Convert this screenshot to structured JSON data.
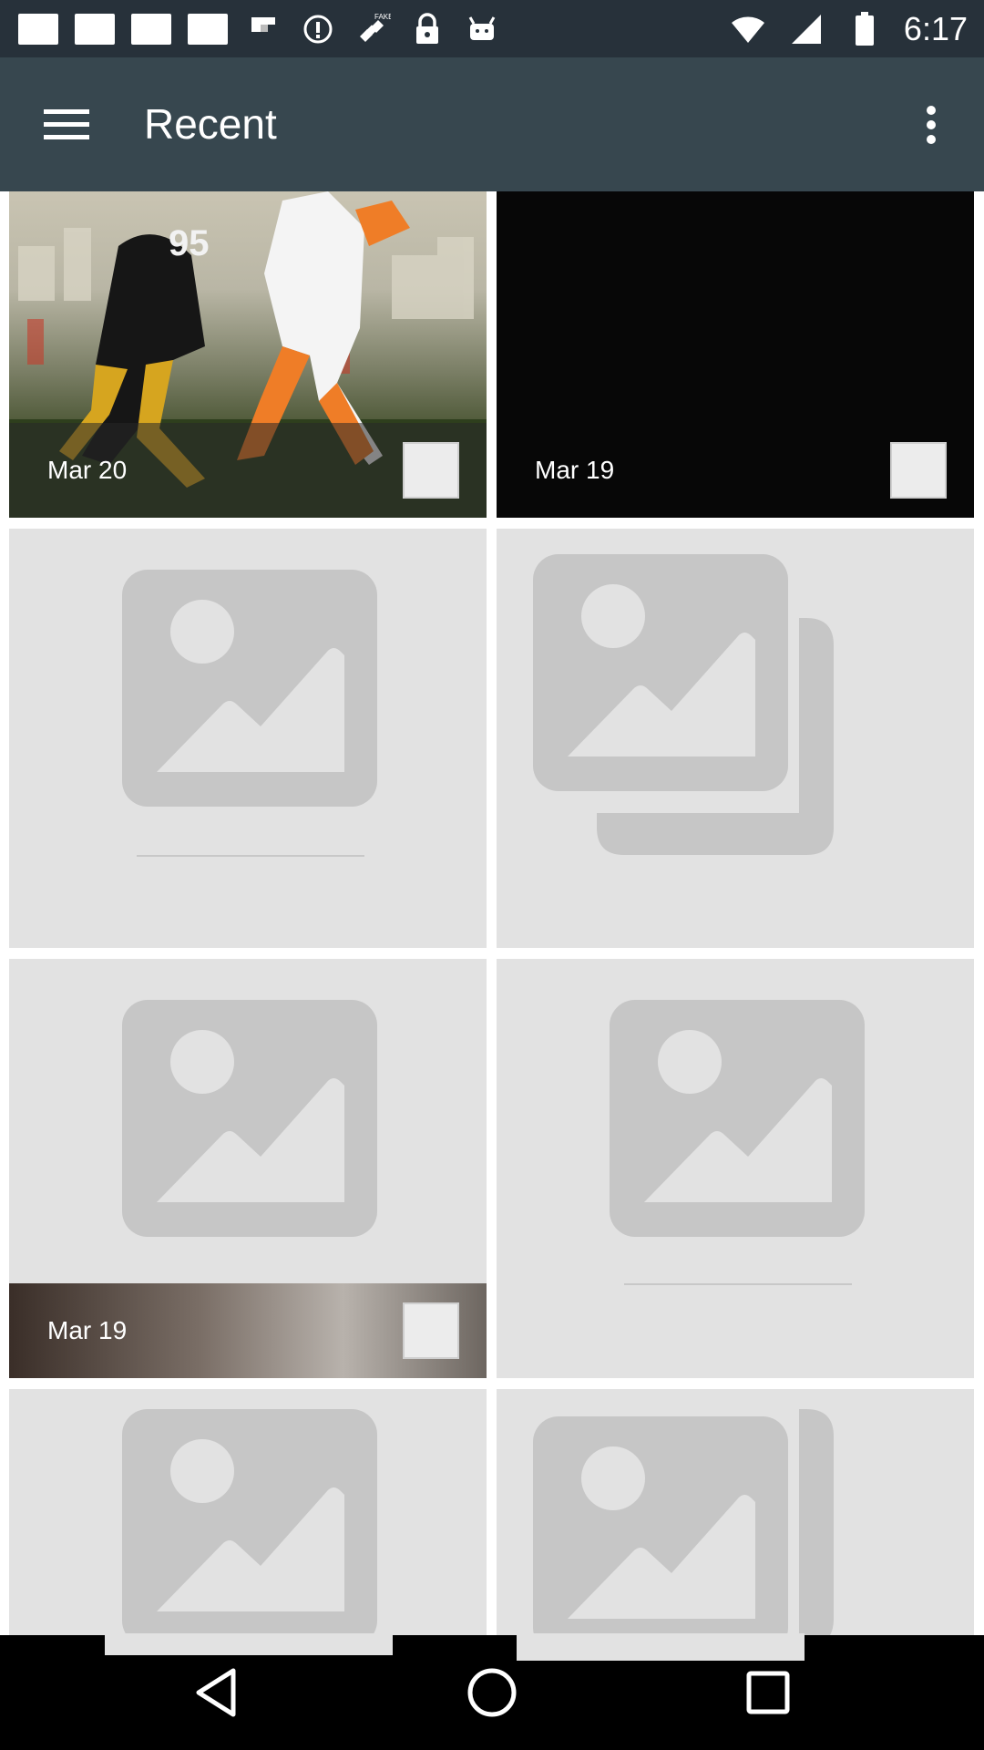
{
  "status_bar": {
    "time": "6:17",
    "icons": [
      "notification-square-icon",
      "notification-square-icon",
      "notification-square-icon",
      "notification-square-icon",
      "flipboard-icon",
      "info-icon",
      "satellite-fake-gps-icon",
      "lock-icon",
      "android-icon"
    ],
    "fake_label": "FAKE"
  },
  "app_bar": {
    "title": "Recent",
    "menu_icon": "hamburger-menu-icon",
    "more_icon": "more-vertical-icon"
  },
  "grid": {
    "tiles": [
      {
        "caption": "Mar 20",
        "kind": "photo"
      },
      {
        "caption": "Mar 19",
        "kind": "photo"
      },
      {
        "caption": "",
        "kind": "image-placeholder"
      },
      {
        "caption": "",
        "kind": "multi-image-placeholder"
      },
      {
        "caption": "Mar 19",
        "kind": "image-placeholder"
      },
      {
        "caption": "",
        "kind": "image-placeholder"
      },
      {
        "caption": "",
        "kind": "image-placeholder"
      },
      {
        "caption": "",
        "kind": "multi-image-placeholder"
      }
    ]
  },
  "nav_bar": {
    "back_icon": "back-triangle-icon",
    "home_icon": "home-circle-icon",
    "recents_icon": "recents-square-icon"
  },
  "colors": {
    "status_bar": "#27313a",
    "app_bar": "#37474f",
    "tile_bg": "#e2e2e2",
    "placeholder": "#c6c6c6"
  }
}
